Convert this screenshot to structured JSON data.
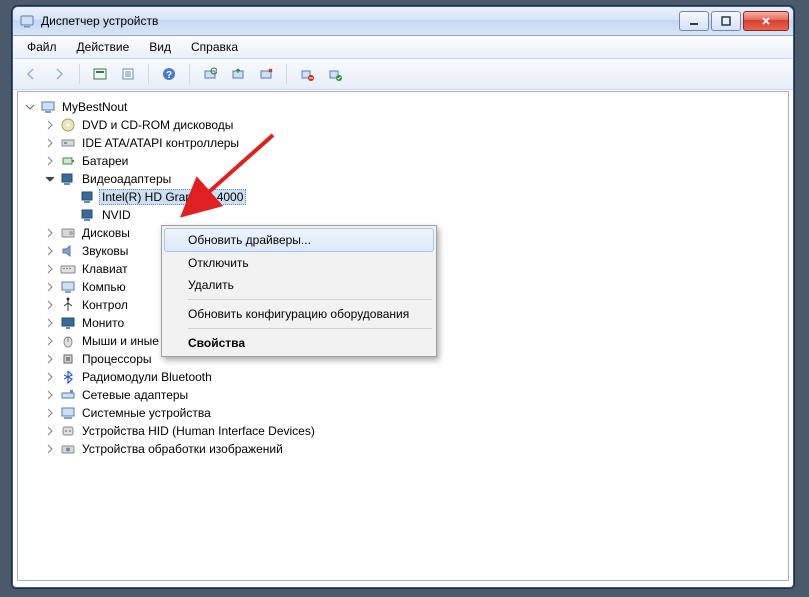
{
  "window": {
    "title": "Диспетчер устройств"
  },
  "menu": {
    "file": "Файл",
    "action": "Действие",
    "view": "Вид",
    "help": "Справка"
  },
  "tree": {
    "root": "MyBestNout",
    "dvd": "DVD и CD-ROM дисководы",
    "ide": "IDE ATA/ATAPI контроллеры",
    "battery": "Батареи",
    "video": "Видеоадаптеры",
    "video_intel": "Intel(R) HD Graphics 4000",
    "video_nvid": "NVID",
    "disk": "Дисковы",
    "sound": "Звуковы",
    "keyboard": "Клавиат",
    "computer": "Компью",
    "controllers": "Контрол",
    "monitor": "Монито",
    "mouse": "Мыши и иные указывающие устройства",
    "cpu": "Процессоры",
    "bluetooth": "Радиомодули Bluetooth",
    "netadapters": "Сетевые адаптеры",
    "sysdevices": "Системные устройства",
    "hid": "Устройства HID (Human Interface Devices)",
    "imaging": "Устройства обработки изображений"
  },
  "context_menu": {
    "update": "Обновить драйверы...",
    "disable": "Отключить",
    "delete": "Удалить",
    "scan": "Обновить конфигурацию оборудования",
    "properties": "Свойства"
  }
}
